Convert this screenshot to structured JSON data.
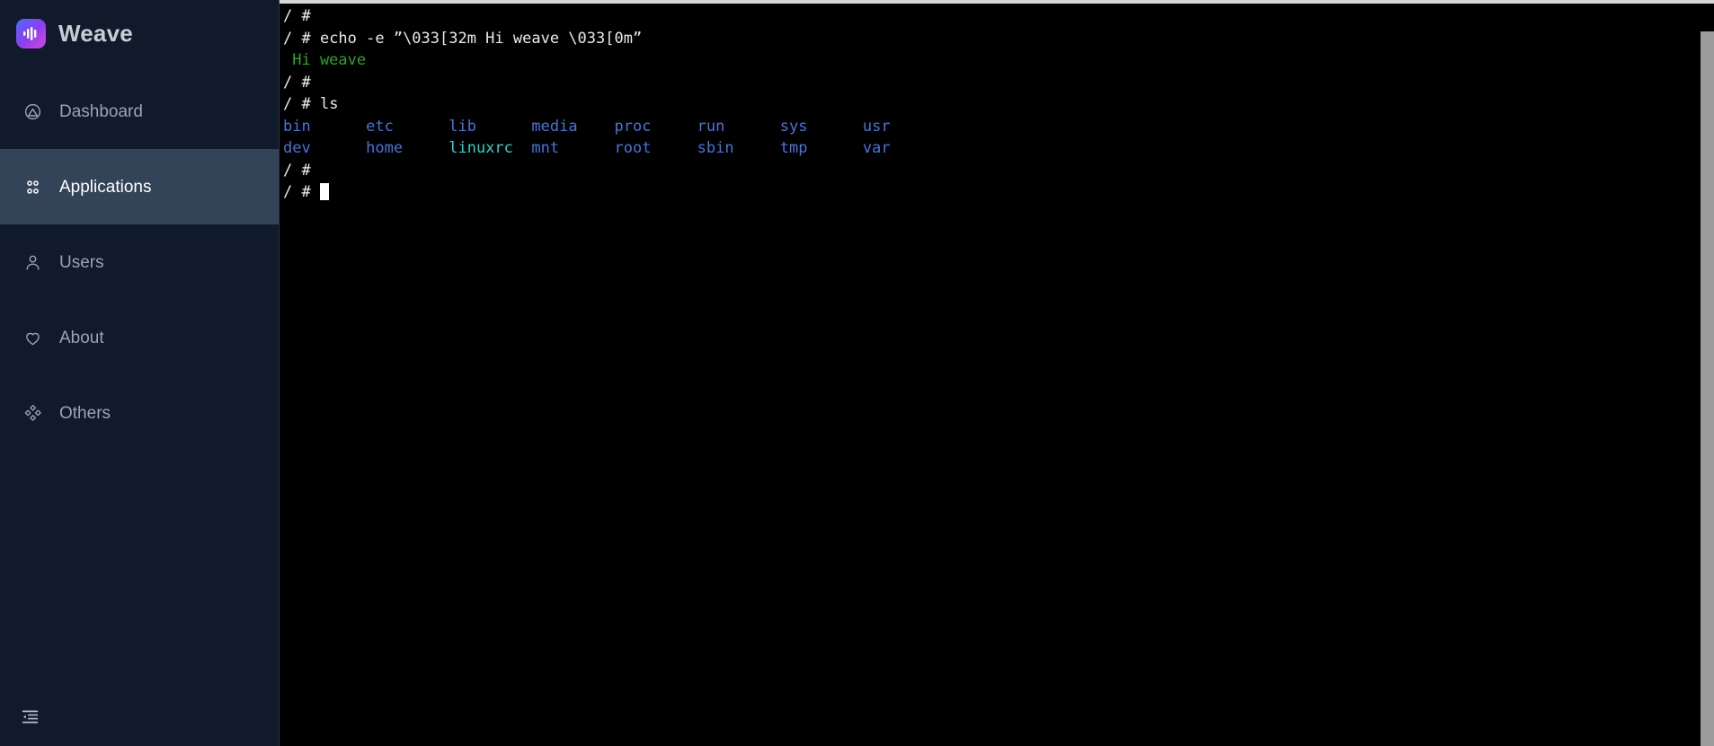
{
  "brand": {
    "name": "Weave",
    "logo_icon": "waveform-icon",
    "logo_gradient_from": "#4f6bf6",
    "logo_gradient_to": "#d549d8"
  },
  "sidebar": {
    "background": "#111a2b",
    "active_background": "#344458",
    "items": [
      {
        "id": "dashboard",
        "label": "Dashboard",
        "icon": "gauge-icon",
        "active": false
      },
      {
        "id": "applications",
        "label": "Applications",
        "icon": "grid-dots-icon",
        "active": true
      },
      {
        "id": "users",
        "label": "Users",
        "icon": "user-icon",
        "active": false
      },
      {
        "id": "about",
        "label": "About",
        "icon": "heart-icon",
        "active": false
      },
      {
        "id": "others",
        "label": "Others",
        "icon": "diamonds-icon",
        "active": false
      }
    ],
    "footer": {
      "collapse_label": "",
      "collapse_icon": "collapse-sidebar-icon"
    }
  },
  "terminal": {
    "background": "#000000",
    "prompt": "/ # ",
    "colors": {
      "text": "#e9e9e9",
      "directory": "#4a74d8",
      "symlink": "#2fd0d0",
      "echo_green": "#2fa32f"
    },
    "lines": [
      {
        "type": "prompt",
        "prompt": "/ # ",
        "command": ""
      },
      {
        "type": "prompt",
        "prompt": "/ # ",
        "command": "echo -e ”\\033[32m Hi weave \\033[0m”"
      },
      {
        "type": "output",
        "color": "green",
        "text": " Hi weave"
      },
      {
        "type": "prompt",
        "prompt": "/ # ",
        "command": ""
      },
      {
        "type": "prompt",
        "prompt": "/ # ",
        "command": "ls"
      },
      {
        "type": "ls_row",
        "entries": [
          {
            "name": "bin",
            "kind": "dir"
          },
          {
            "name": "etc",
            "kind": "dir"
          },
          {
            "name": "lib",
            "kind": "dir"
          },
          {
            "name": "media",
            "kind": "dir"
          },
          {
            "name": "proc",
            "kind": "dir"
          },
          {
            "name": "run",
            "kind": "dir"
          },
          {
            "name": "sys",
            "kind": "dir"
          },
          {
            "name": "usr",
            "kind": "dir"
          }
        ]
      },
      {
        "type": "ls_row",
        "entries": [
          {
            "name": "dev",
            "kind": "dir"
          },
          {
            "name": "home",
            "kind": "dir"
          },
          {
            "name": "linuxrc",
            "kind": "symlink"
          },
          {
            "name": "mnt",
            "kind": "dir"
          },
          {
            "name": "root",
            "kind": "dir"
          },
          {
            "name": "sbin",
            "kind": "dir"
          },
          {
            "name": "tmp",
            "kind": "dir"
          },
          {
            "name": "var",
            "kind": "dir"
          }
        ]
      },
      {
        "type": "prompt",
        "prompt": "/ # ",
        "command": ""
      },
      {
        "type": "prompt",
        "prompt": "/ # ",
        "command": "",
        "cursor": true
      }
    ],
    "scrollbar": {
      "visible": true,
      "position": "right"
    }
  }
}
